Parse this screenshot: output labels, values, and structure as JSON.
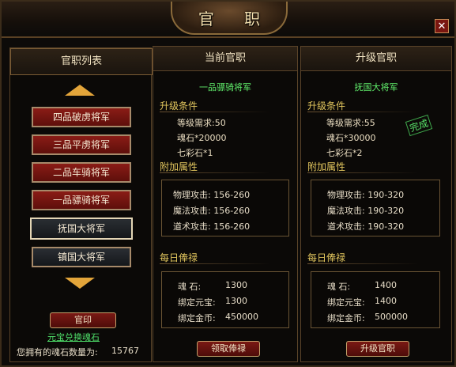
{
  "window": {
    "title": "官 职",
    "close_glyph": "✕"
  },
  "left": {
    "header": "官职列表",
    "ranks": [
      {
        "label": "四品破虏将军",
        "state": "red"
      },
      {
        "label": "三品平虏将军",
        "state": "red"
      },
      {
        "label": "二品车骑将军",
        "state": "red"
      },
      {
        "label": "一品骠骑将军",
        "state": "red"
      },
      {
        "label": "抚国大将军",
        "state": "selected"
      },
      {
        "label": "镇国大将军",
        "state": "grey"
      }
    ],
    "seal_button": "官印",
    "exchange_link": "元宝兑换魂石",
    "soulstone_label": "您拥有的魂石数量为:",
    "soulstone_value": "15767"
  },
  "current": {
    "header": "当前官职",
    "rank": "一品骠骑将军",
    "upgrade_title": "升级条件",
    "req_level": "等级需求:50",
    "req_soul": "魂石*20000",
    "req_gem": "七彩石*1",
    "attr_title": "附加属性",
    "attrs": [
      "物理攻击: 156-260",
      "魔法攻击: 156-260",
      "道术攻击: 156-260"
    ],
    "salary_title": "每日俸禄",
    "salary_labels": [
      "魂      石:",
      "绑定元宝:",
      "绑定金币:"
    ],
    "salary_values": [
      "1300",
      "1300",
      "450000"
    ],
    "button": "领取俸禄"
  },
  "upgrade": {
    "header": "升级官职",
    "rank": "抚国大将军",
    "upgrade_title": "升级条件",
    "req_level": "等级需求:55",
    "req_soul": "魂石*30000",
    "req_gem": "七彩石*2",
    "done_stamp": "完成",
    "attr_title": "附加属性",
    "attrs": [
      "物理攻击: 190-320",
      "魔法攻击: 190-320",
      "道术攻击: 190-320"
    ],
    "salary_title": "每日俸禄",
    "salary_labels": [
      "魂      石:",
      "绑定元宝:",
      "绑定金币:"
    ],
    "salary_values": [
      "1400",
      "1400",
      "500000"
    ],
    "button": "升级官职"
  },
  "colors": {
    "accent_gold": "#e3a53a",
    "button_red": "#8a1c16",
    "green_text": "#61f06c"
  }
}
